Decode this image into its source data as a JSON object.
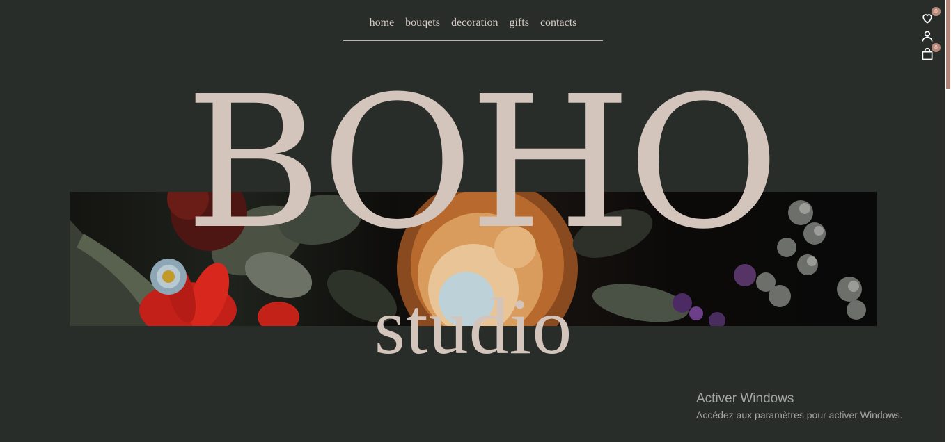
{
  "nav": {
    "items": [
      {
        "label": "home"
      },
      {
        "label": "bouqets"
      },
      {
        "label": "decoration"
      },
      {
        "label": "gifts"
      },
      {
        "label": "contacts"
      }
    ]
  },
  "header_icons": {
    "wishlist": {
      "icon": "heart-icon",
      "count": "0"
    },
    "account": {
      "icon": "user-icon"
    },
    "cart": {
      "icon": "shopping-bag-icon",
      "count": "0"
    }
  },
  "hero": {
    "title": "BOHO",
    "subtitle": "studio",
    "image_alt": "dark floral arrangement"
  },
  "watermark": {
    "title": "Activer Windows",
    "subtitle": "Accédez aux paramètres pour activer Windows."
  },
  "colors": {
    "background": "#292d2a",
    "text": "#d3c5bb",
    "accent": "#b8877a"
  }
}
